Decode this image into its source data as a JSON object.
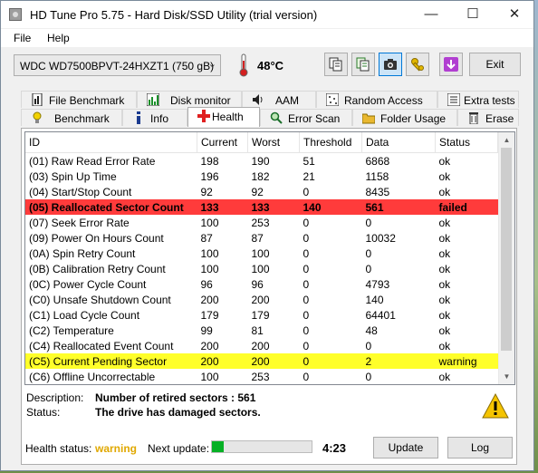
{
  "window": {
    "title": "HD Tune Pro 5.75 - Hard Disk/SSD Utility (trial version)"
  },
  "menu": {
    "file": "File",
    "help": "Help"
  },
  "toolbar": {
    "drive": "WDC WD7500BPVT-24HXZT1 (750 gB)",
    "temperature": "48°C",
    "exit_label": "Exit"
  },
  "tabs_top": [
    "File Benchmark",
    "Disk monitor",
    "AAM",
    "Random Access",
    "Extra tests"
  ],
  "tabs_bottom": [
    "Benchmark",
    "Info",
    "Health",
    "Error Scan",
    "Folder Usage",
    "Erase"
  ],
  "active_tab": "Health",
  "table": {
    "columns": [
      "ID",
      "Current",
      "Worst",
      "Threshold",
      "Data",
      "Status"
    ],
    "rows": [
      [
        "(01) Raw Read Error Rate",
        "198",
        "190",
        "51",
        "6868",
        "ok"
      ],
      [
        "(03) Spin Up Time",
        "196",
        "182",
        "21",
        "1158",
        "ok"
      ],
      [
        "(04) Start/Stop Count",
        "92",
        "92",
        "0",
        "8435",
        "ok"
      ],
      [
        "(05) Reallocated Sector Count",
        "133",
        "133",
        "140",
        "561",
        "failed"
      ],
      [
        "(07) Seek Error Rate",
        "100",
        "253",
        "0",
        "0",
        "ok"
      ],
      [
        "(09) Power On Hours Count",
        "87",
        "87",
        "0",
        "10032",
        "ok"
      ],
      [
        "(0A) Spin Retry Count",
        "100",
        "100",
        "0",
        "0",
        "ok"
      ],
      [
        "(0B) Calibration Retry Count",
        "100",
        "100",
        "0",
        "0",
        "ok"
      ],
      [
        "(0C) Power Cycle Count",
        "96",
        "96",
        "0",
        "4793",
        "ok"
      ],
      [
        "(C0) Unsafe Shutdown Count",
        "200",
        "200",
        "0",
        "140",
        "ok"
      ],
      [
        "(C1) Load Cycle Count",
        "179",
        "179",
        "0",
        "64401",
        "ok"
      ],
      [
        "(C2) Temperature",
        "99",
        "81",
        "0",
        "48",
        "ok"
      ],
      [
        "(C4) Reallocated Event Count",
        "200",
        "200",
        "0",
        "0",
        "ok"
      ],
      [
        "(C5) Current Pending Sector",
        "200",
        "200",
        "0",
        "2",
        "warning"
      ],
      [
        "(C6) Offline Uncorrectable",
        "100",
        "253",
        "0",
        "0",
        "ok"
      ]
    ]
  },
  "description": {
    "label": "Description:",
    "value": "Number of retired sectors : 561",
    "status_label": "Status:",
    "status_value": "The drive has damaged sectors."
  },
  "footer": {
    "health_label": "Health status:",
    "health_value": "warning",
    "next_update_label": "Next update:",
    "progress_fraction": 0.12,
    "timer": "4:23",
    "update_label": "Update",
    "log_label": "Log"
  },
  "colors": {
    "failed_row": "#ff3b3b",
    "warning_row": "#ffff2a",
    "health_warning_text": "#e0a800",
    "progress": "#06b025"
  }
}
